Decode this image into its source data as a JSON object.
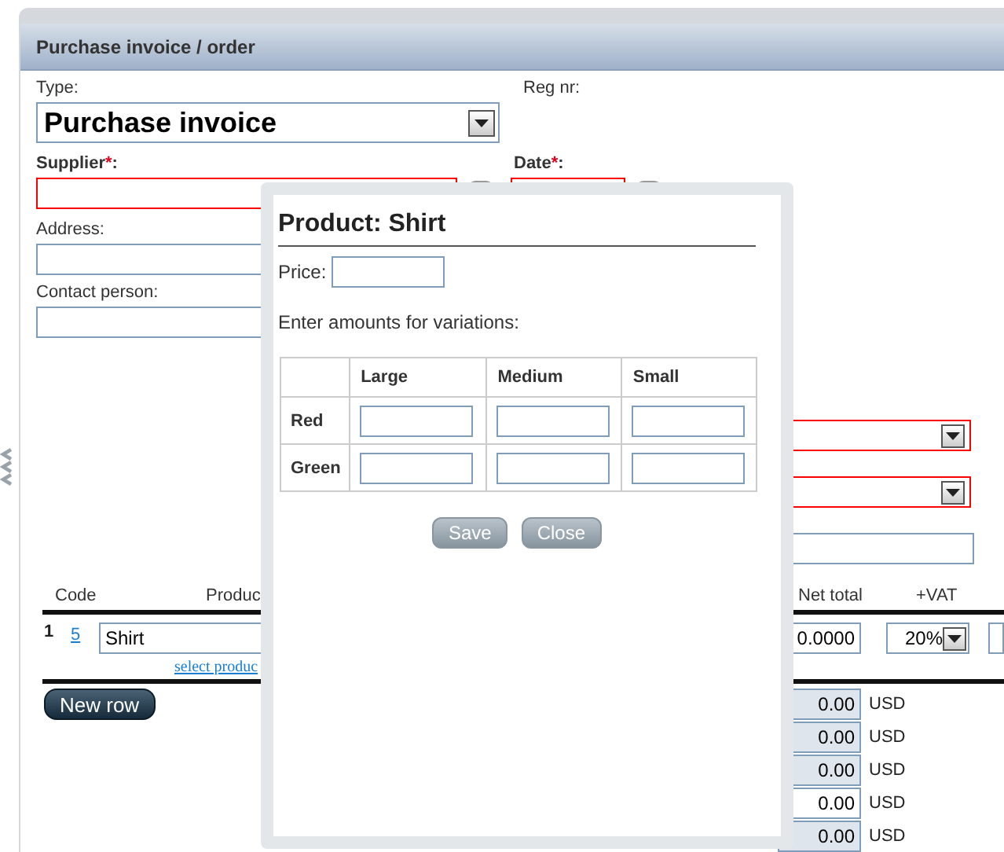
{
  "window": {
    "title": "Purchase invoice / order"
  },
  "header": {
    "type_label": "Type:",
    "type_value": "Purchase invoice",
    "reg_label": "Reg nr:"
  },
  "supplier": {
    "label": "Supplier",
    "mark": "*",
    "colon": ":",
    "invalid": true
  },
  "date": {
    "label": "Date",
    "mark": "*",
    "colon": ":",
    "invalid": true
  },
  "address": {
    "label": "Address:"
  },
  "contact": {
    "label": "Contact person:"
  },
  "side_selects": [
    {
      "invalid": true
    },
    {
      "invalid": true
    }
  ],
  "columns": [
    "Code",
    "Produc",
    "Net total",
    "+VAT"
  ],
  "rows": [
    {
      "number": "1",
      "code": "5",
      "product": "Shirt",
      "select_link": "select produc",
      "net_total": "0.0000",
      "vat": "20%"
    }
  ],
  "new_row_button": "New row",
  "totals": [
    {
      "value": "0.00",
      "currency": "USD",
      "readonly": true
    },
    {
      "value": "0.00",
      "currency": "USD",
      "readonly": true
    },
    {
      "value": "0.00",
      "currency": "USD",
      "readonly": true
    },
    {
      "value": "0.00",
      "currency": "USD",
      "readonly": false
    },
    {
      "value": "0.00",
      "currency": "USD",
      "readonly": true
    }
  ],
  "dialog": {
    "title": "Product: Shirt",
    "price_label": "Price:",
    "prompt": "Enter amounts for variations:",
    "sizes": [
      "Large",
      "Medium",
      "Small"
    ],
    "colors": [
      "Red",
      "Green"
    ],
    "buttons": [
      "Save",
      "Close"
    ]
  }
}
